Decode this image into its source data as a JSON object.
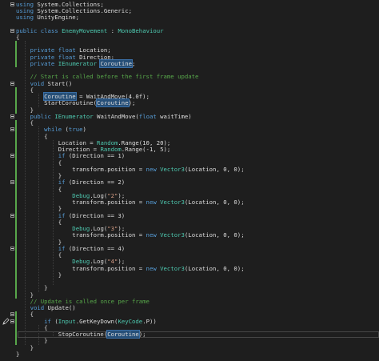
{
  "editor": {
    "lines": [
      [
        {
          "t": "using",
          "c": "kw"
        },
        {
          "t": " System.Collections;",
          "c": "plain"
        }
      ],
      [
        {
          "t": "using",
          "c": "kw"
        },
        {
          "t": " System.Collections.Generic;",
          "c": "plain"
        }
      ],
      [
        {
          "t": "using",
          "c": "kw"
        },
        {
          "t": " UnityEngine;",
          "c": "plain"
        }
      ],
      [],
      [
        {
          "t": "public",
          "c": "kw"
        },
        {
          "t": " ",
          "c": "plain"
        },
        {
          "t": "class",
          "c": "kw"
        },
        {
          "t": " ",
          "c": "plain"
        },
        {
          "t": "EnemyMovement",
          "c": "type"
        },
        {
          "t": " : ",
          "c": "plain"
        },
        {
          "t": "MonoBehaviour",
          "c": "type"
        }
      ],
      [
        {
          "t": "{",
          "c": "plain"
        }
      ],
      [],
      [
        {
          "t": "    ",
          "c": "plain"
        },
        {
          "t": "private",
          "c": "kw"
        },
        {
          "t": " ",
          "c": "plain"
        },
        {
          "t": "float",
          "c": "kw"
        },
        {
          "t": " Location;",
          "c": "plain"
        }
      ],
      [
        {
          "t": "    ",
          "c": "plain"
        },
        {
          "t": "private",
          "c": "kw"
        },
        {
          "t": " ",
          "c": "plain"
        },
        {
          "t": "float",
          "c": "kw"
        },
        {
          "t": " Direction;",
          "c": "plain"
        }
      ],
      [
        {
          "t": "    ",
          "c": "plain"
        },
        {
          "t": "private",
          "c": "kw"
        },
        {
          "t": " ",
          "c": "plain"
        },
        {
          "t": "IEnumerator",
          "c": "type"
        },
        {
          "t": " ",
          "c": "plain"
        },
        {
          "t": "Coroutine",
          "c": "hl"
        },
        {
          "t": ";",
          "c": "plain"
        }
      ],
      [],
      [
        {
          "t": "    ",
          "c": "plain"
        },
        {
          "t": "// Start is called before the first frame update",
          "c": "cm"
        }
      ],
      [
        {
          "t": "    ",
          "c": "plain"
        },
        {
          "t": "void",
          "c": "kw"
        },
        {
          "t": " Start()",
          "c": "plain"
        }
      ],
      [
        {
          "t": "    {",
          "c": "plain"
        }
      ],
      [
        {
          "t": "        ",
          "c": "plain"
        },
        {
          "t": "Coroutine",
          "c": "hl"
        },
        {
          "t": " = WaitAndMove(4.0f);",
          "c": "plain"
        }
      ],
      [
        {
          "t": "        StartCoroutine(",
          "c": "plain"
        },
        {
          "t": "Coroutine",
          "c": "hl"
        },
        {
          "t": ");",
          "c": "plain"
        }
      ],
      [
        {
          "t": "    }",
          "c": "plain"
        }
      ],
      [
        {
          "t": "    ",
          "c": "plain"
        },
        {
          "t": "public",
          "c": "kw"
        },
        {
          "t": " ",
          "c": "plain"
        },
        {
          "t": "IEnumerator",
          "c": "type"
        },
        {
          "t": " WaitAndMove(",
          "c": "plain"
        },
        {
          "t": "float",
          "c": "kw"
        },
        {
          "t": " waitTime)",
          "c": "plain"
        }
      ],
      [
        {
          "t": "    {",
          "c": "plain"
        }
      ],
      [
        {
          "t": "        ",
          "c": "plain"
        },
        {
          "t": "while",
          "c": "kw"
        },
        {
          "t": " (",
          "c": "plain"
        },
        {
          "t": "true",
          "c": "kw"
        },
        {
          "t": ")",
          "c": "plain"
        }
      ],
      [
        {
          "t": "        {",
          "c": "plain"
        }
      ],
      [
        {
          "t": "            Location = ",
          "c": "plain"
        },
        {
          "t": "Random",
          "c": "type"
        },
        {
          "t": ".Range(10, 20);",
          "c": "plain"
        }
      ],
      [
        {
          "t": "            Direction = ",
          "c": "plain"
        },
        {
          "t": "Random",
          "c": "type"
        },
        {
          "t": ".Range(-1, 5);",
          "c": "plain"
        }
      ],
      [
        {
          "t": "            ",
          "c": "plain"
        },
        {
          "t": "if",
          "c": "kw"
        },
        {
          "t": " (Direction == 1)",
          "c": "plain"
        }
      ],
      [
        {
          "t": "            {",
          "c": "plain"
        }
      ],
      [
        {
          "t": "                transform.position = ",
          "c": "plain"
        },
        {
          "t": "new",
          "c": "kw"
        },
        {
          "t": " ",
          "c": "plain"
        },
        {
          "t": "Vector3",
          "c": "type"
        },
        {
          "t": "(Location, 0, 0);",
          "c": "plain"
        }
      ],
      [
        {
          "t": "            }",
          "c": "plain"
        }
      ],
      [
        {
          "t": "            ",
          "c": "plain"
        },
        {
          "t": "if",
          "c": "kw"
        },
        {
          "t": " (Direction == 2)",
          "c": "plain"
        }
      ],
      [
        {
          "t": "            {",
          "c": "plain"
        }
      ],
      [
        {
          "t": "                ",
          "c": "plain"
        },
        {
          "t": "Debug",
          "c": "type"
        },
        {
          "t": ".Log(",
          "c": "plain"
        },
        {
          "t": "\"2\"",
          "c": "str"
        },
        {
          "t": ");",
          "c": "plain"
        }
      ],
      [
        {
          "t": "                transform.position = ",
          "c": "plain"
        },
        {
          "t": "new",
          "c": "kw"
        },
        {
          "t": " ",
          "c": "plain"
        },
        {
          "t": "Vector3",
          "c": "type"
        },
        {
          "t": "(Location, 0, 0);",
          "c": "plain"
        }
      ],
      [
        {
          "t": "            }",
          "c": "plain"
        }
      ],
      [
        {
          "t": "            ",
          "c": "plain"
        },
        {
          "t": "if",
          "c": "kw"
        },
        {
          "t": " (Direction == 3)",
          "c": "plain"
        }
      ],
      [
        {
          "t": "            {",
          "c": "plain"
        }
      ],
      [
        {
          "t": "                ",
          "c": "plain"
        },
        {
          "t": "Debug",
          "c": "type"
        },
        {
          "t": ".Log(",
          "c": "plain"
        },
        {
          "t": "\"3\"",
          "c": "str"
        },
        {
          "t": ");",
          "c": "plain"
        }
      ],
      [
        {
          "t": "                transform.position = ",
          "c": "plain"
        },
        {
          "t": "new",
          "c": "kw"
        },
        {
          "t": " ",
          "c": "plain"
        },
        {
          "t": "Vector3",
          "c": "type"
        },
        {
          "t": "(Location, 0, 0);",
          "c": "plain"
        }
      ],
      [
        {
          "t": "            }",
          "c": "plain"
        }
      ],
      [
        {
          "t": "            ",
          "c": "plain"
        },
        {
          "t": "if",
          "c": "kw"
        },
        {
          "t": " (Direction == 4)",
          "c": "plain"
        }
      ],
      [
        {
          "t": "            {",
          "c": "plain"
        }
      ],
      [
        {
          "t": "                ",
          "c": "plain"
        },
        {
          "t": "Debug",
          "c": "type"
        },
        {
          "t": ".Log(",
          "c": "plain"
        },
        {
          "t": "\"4\"",
          "c": "str"
        },
        {
          "t": ");",
          "c": "plain"
        }
      ],
      [
        {
          "t": "                transform.position = ",
          "c": "plain"
        },
        {
          "t": "new",
          "c": "kw"
        },
        {
          "t": " ",
          "c": "plain"
        },
        {
          "t": "Vector3",
          "c": "type"
        },
        {
          "t": "(Location, 0, 0);",
          "c": "plain"
        }
      ],
      [
        {
          "t": "            }",
          "c": "plain"
        }
      ],
      [],
      [
        {
          "t": "        }",
          "c": "plain"
        }
      ],
      [
        {
          "t": "    }",
          "c": "plain"
        }
      ],
      [
        {
          "t": "    ",
          "c": "plain"
        },
        {
          "t": "// Update is called once per frame",
          "c": "cm"
        }
      ],
      [
        {
          "t": "    ",
          "c": "plain"
        },
        {
          "t": "void",
          "c": "kw"
        },
        {
          "t": " Update()",
          "c": "plain"
        }
      ],
      [
        {
          "t": "    {",
          "c": "plain"
        }
      ],
      [
        {
          "t": "        ",
          "c": "plain"
        },
        {
          "t": "if",
          "c": "kw"
        },
        {
          "t": " (",
          "c": "plain"
        },
        {
          "t": "Input",
          "c": "type"
        },
        {
          "t": ".GetKeyDown(",
          "c": "plain"
        },
        {
          "t": "KeyCode",
          "c": "type"
        },
        {
          "t": ".P))",
          "c": "plain"
        }
      ],
      [
        {
          "t": "        {",
          "c": "plain"
        }
      ],
      [
        {
          "t": "            StopCoroutine(",
          "c": "plain"
        },
        {
          "t": "Coroutine",
          "c": "hl"
        },
        {
          "t": ");",
          "c": "plain"
        }
      ],
      [
        {
          "t": "        }",
          "c": "plain"
        }
      ],
      [
        {
          "t": "    }",
          "c": "plain"
        }
      ],
      [
        {
          "t": "}",
          "c": "plain"
        }
      ]
    ],
    "colors": {
      "background": "#1e1e1e",
      "keyword": "#569cd6",
      "type": "#4ec9b0",
      "string": "#d69d85",
      "comment": "#57a64a",
      "highlight": "#264f78",
      "change_bar": "#57a64a"
    },
    "current_line_number": 50,
    "icons": [
      "fold-icon",
      "edit-pencil-icon"
    ]
  }
}
